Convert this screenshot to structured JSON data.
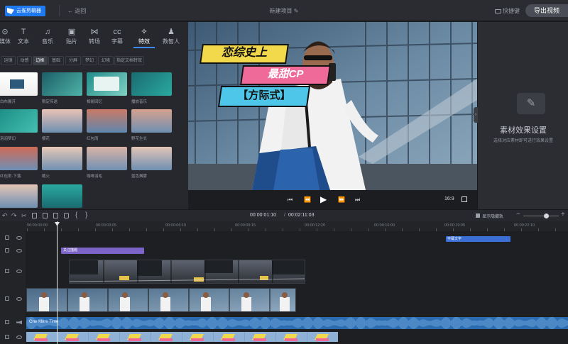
{
  "app": {
    "logo_text": "云雀剪辑器",
    "back_label": "返回",
    "project_title": "新建项目",
    "shortcut_label": "快捷键",
    "export_label": "导出视频"
  },
  "tabs": [
    {
      "label": "媒体",
      "icon": "search-icon"
    },
    {
      "label": "文本",
      "icon": "text-icon"
    },
    {
      "label": "音乐",
      "icon": "music-icon"
    },
    {
      "label": "贴片",
      "icon": "image-icon"
    },
    {
      "label": "转场",
      "icon": "transition-icon"
    },
    {
      "label": "字幕",
      "icon": "caption-icon"
    },
    {
      "label": "特效",
      "icon": "magic-wand-icon",
      "active": true
    },
    {
      "label": "数智人",
      "icon": "person-icon"
    }
  ],
  "subtabs": [
    {
      "label": "运镜"
    },
    {
      "label": "动感"
    },
    {
      "label": "边框",
      "active": true
    },
    {
      "label": "基础"
    },
    {
      "label": "分屏"
    },
    {
      "label": "梦幻"
    },
    {
      "label": "幻境"
    },
    {
      "label": "指定文档特效"
    }
  ],
  "effects": [
    {
      "label": "白布展开"
    },
    {
      "label": "限定传送"
    },
    {
      "label": "相册回忆"
    },
    {
      "label": "播放音乐"
    },
    {
      "label": "泡泡梦幻"
    },
    {
      "label": "樱花"
    },
    {
      "label": "红包雨"
    },
    {
      "label": "野花生长"
    },
    {
      "label": "红包雨·下落"
    },
    {
      "label": "截火"
    },
    {
      "label": "咖啡羽毛"
    },
    {
      "label": "蓝色烟雾"
    },
    {
      "label": ""
    },
    {
      "label": ""
    }
  ],
  "overlay": {
    "line1": "恋综史上",
    "line2": "最甜CP",
    "line3": "【方际式】"
  },
  "player": {
    "aspect": "16:9"
  },
  "right_panel": {
    "title": "素材效果设置",
    "hint": "选择对应素材即可进行效果设置"
  },
  "timeline": {
    "current_time": "00:00:01:10",
    "total_time": "00:02:11:03",
    "separator": "/",
    "show_track_label": "显示隐藏轨",
    "ruler": [
      "00:00:00:00",
      "00:00:03:05",
      "00:00:06:10",
      "00:00:09:15",
      "00:00:12:20",
      "00:00:16:00",
      "00:00:19:05",
      "00:00:22:10"
    ],
    "clips": {
      "caption": "字幕文字",
      "effect": "关注描题",
      "audio": "One More Time"
    }
  },
  "colors": {
    "accent": "#1f79f0",
    "effect_clip": "#7b63c8",
    "caption_clip": "#3b6fd6",
    "audio_clip": "#2b6cb0"
  }
}
